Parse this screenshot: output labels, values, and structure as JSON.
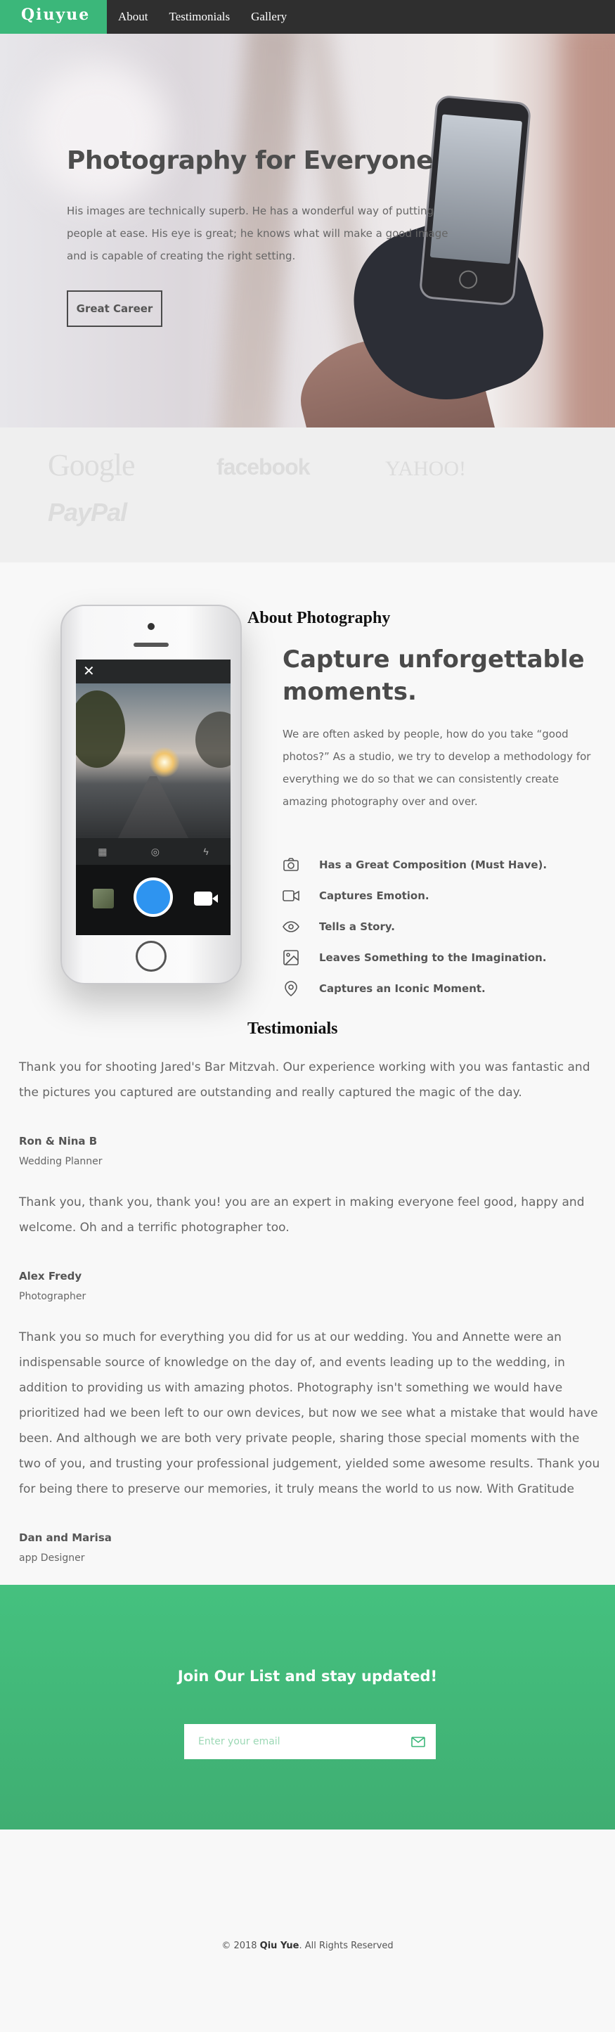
{
  "nav": {
    "logo": "Qiuyue",
    "links": [
      "About",
      "Testimonials",
      "Gallery"
    ]
  },
  "hero": {
    "title": "Photography for Everyone",
    "text": "His images are technically superb. He has a wonderful way of putting people at ease. His eye is great; he knows what will make a good image and is capable of creating the right setting.",
    "button": "Great Career"
  },
  "brands": [
    "Google",
    "facebook",
    "YAHOO!",
    "PayPal"
  ],
  "about": {
    "label": "About Photography",
    "title": "Capture unforgettable moments.",
    "text": "We are often asked by people, how do you take “good photos?” As a studio, we try to develop a methodology for everything we do so that we can consistently create amazing photography over and over.",
    "features": [
      {
        "icon": "camera-icon",
        "label": "Has a Great Composition (Must Have)."
      },
      {
        "icon": "video-icon",
        "label": "Captures Emotion."
      },
      {
        "icon": "eye-icon",
        "label": "Tells a Story."
      },
      {
        "icon": "image-icon",
        "label": "Leaves Something to the Imagination."
      },
      {
        "icon": "location-pin-icon",
        "label": "Captures an Iconic Moment."
      }
    ]
  },
  "testimonials": {
    "label": "Testimonials",
    "items": [
      {
        "quote": "Thank you for shooting Jared's Bar Mitzvah. Our experience working with you was fantastic and the pictures you captured are outstanding and really captured the magic of the day.",
        "name": "Ron & Nina B",
        "role": "Wedding Planner"
      },
      {
        "quote": "Thank you, thank you, thank you! you are an expert in making everyone feel good, happy and welcome. Oh and a terrific photographer too.",
        "name": "Alex Fredy",
        "role": "Photographer"
      },
      {
        "quote": "Thank you so much for everything you did for us at our wedding. You and Annette were an indispensable source of knowledge on the day of, and events leading up to the wedding, in addition to providing us with amazing photos. Photography isn't something we would have prioritized had we been left to our own devices, but now we see what a mistake that would have been. And although we are both very private people, sharing those special moments with the two of you, and trusting your professional judgement, yielded some awesome results. Thank you for being there to preserve our memories, it truly means the world to us now. With Gratitude",
        "name": "Dan and Marisa",
        "role": "app Designer"
      }
    ]
  },
  "newsletter": {
    "title": "Join Our List and stay updated!",
    "placeholder": "Enter your email"
  },
  "footer": {
    "prefix": "© 2018 ",
    "name": "Qiu Yue",
    "suffix": ". All Rights Reserved"
  },
  "colors": {
    "accent": "#3bb77a",
    "nav_bg": "#2f2f2f",
    "shutter": "#2e94f0"
  }
}
